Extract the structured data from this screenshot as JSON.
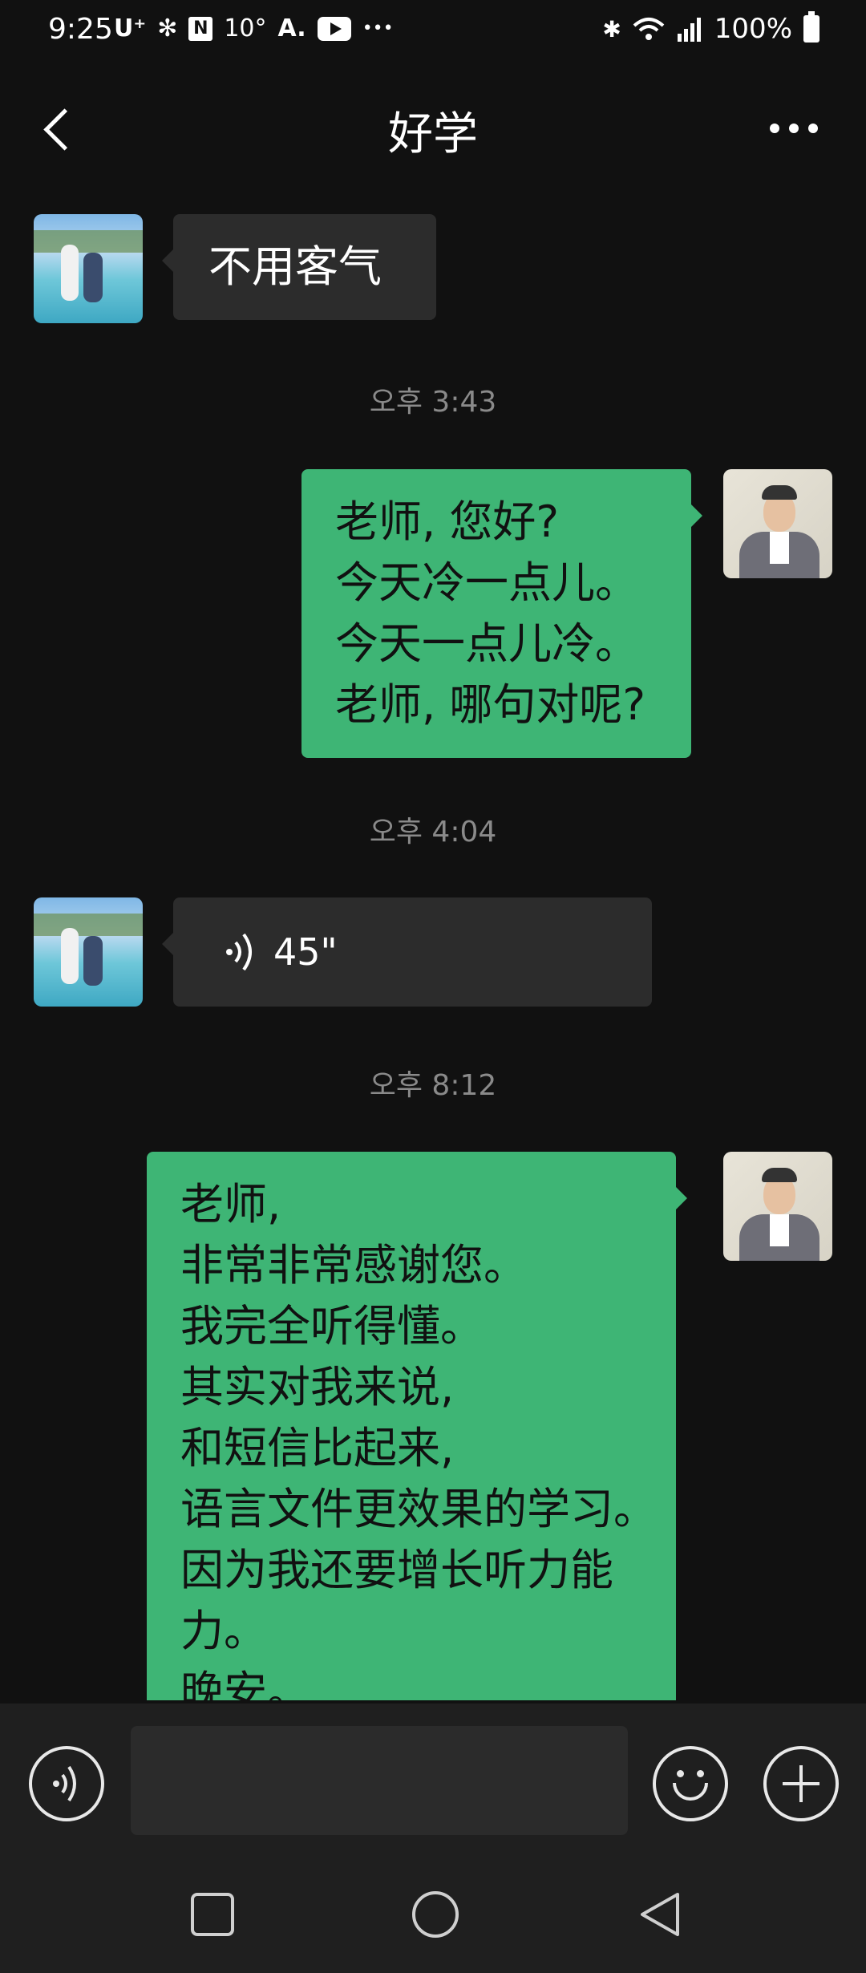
{
  "status_bar": {
    "time": "9:25",
    "carrier": "U⁺",
    "temp": "10°",
    "battery": "100%"
  },
  "header": {
    "title": "好学"
  },
  "messages": [
    {
      "type": "text",
      "side": "in",
      "text": "不用客气"
    },
    {
      "type": "timestamp",
      "text": "오후 3:43"
    },
    {
      "type": "text",
      "side": "out",
      "text": "老师, 您好?\n今天冷一点儿。\n今天一点儿冷。\n老师, 哪句对呢?"
    },
    {
      "type": "timestamp",
      "text": "오후 4:04"
    },
    {
      "type": "voice",
      "side": "in",
      "duration": "45\""
    },
    {
      "type": "timestamp",
      "text": "오후 8:12"
    },
    {
      "type": "text",
      "side": "out",
      "text": "老师,\n非常非常感谢您。\n我完全听得懂。\n其实对我来说,\n和短信比起来,\n语言文件更效果的学习。\n因为我还要增长听力能\n力。\n晚安。"
    }
  ],
  "input": {
    "placeholder": ""
  },
  "colors": {
    "background": "#111111",
    "incoming_bubble": "#2c2c2c",
    "outgoing_bubble": "#3eb575",
    "timestamp": "#8a8a8a"
  },
  "icons": [
    "back-arrow-icon",
    "more-dots-icon",
    "voice-wave-icon",
    "emoji-icon",
    "plus-icon",
    "nav-recent-icon",
    "nav-home-icon",
    "nav-back-icon"
  ]
}
